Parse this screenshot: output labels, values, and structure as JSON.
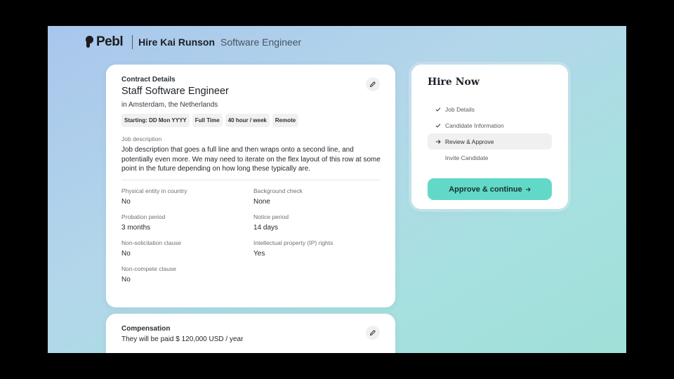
{
  "header": {
    "logo_text": "Pebl",
    "candidate_name": "Hire Kai Runson",
    "role": "Software Engineer"
  },
  "contract": {
    "section_label": "Contract Details",
    "job_title": "Staff Software Engineer",
    "location": "in Amsterdam, the Netherlands",
    "chips": [
      "Starting: DD Mon YYYY",
      "Full Time",
      "40 hour / week",
      "Remote"
    ],
    "description_label": "Job description",
    "description": "Job description that goes a full line and then wraps onto a second line, and potentially even more. We may need to iterate on the flex layout of this row at some point in the future depending on how long these typically are.",
    "fields": [
      {
        "label": "Physical entity in country",
        "value": "No"
      },
      {
        "label": "Background check",
        "value": "None"
      },
      {
        "label": "Probation period",
        "value": "3 months"
      },
      {
        "label": "Notice period",
        "value": "14 days"
      },
      {
        "label": "Non-solicitation clause",
        "value": "No"
      },
      {
        "label": "Intellectual property (IP) rights",
        "value": "Yes"
      },
      {
        "label": "Non-compete clause",
        "value": "No"
      }
    ]
  },
  "compensation": {
    "section_label": "Compensation",
    "text": "They will be paid $ 120,000 USD / year"
  },
  "hire_now": {
    "title": "Hire Now",
    "steps": [
      {
        "label": "Job Details",
        "state": "done"
      },
      {
        "label": "Candidate Information",
        "state": "done"
      },
      {
        "label": "Review & Approve",
        "state": "active"
      },
      {
        "label": "Invite Candidate",
        "state": "pending"
      }
    ],
    "button_label": "Approve & continue"
  },
  "icons": {
    "edit": "pencil-icon",
    "done": "check-icon",
    "active": "arrow-right-icon",
    "button": "arrow-right-icon"
  },
  "colors": {
    "accent_button": "#62d9c8",
    "background_start": "#a8c6ec",
    "background_end": "#9fe0d8"
  }
}
